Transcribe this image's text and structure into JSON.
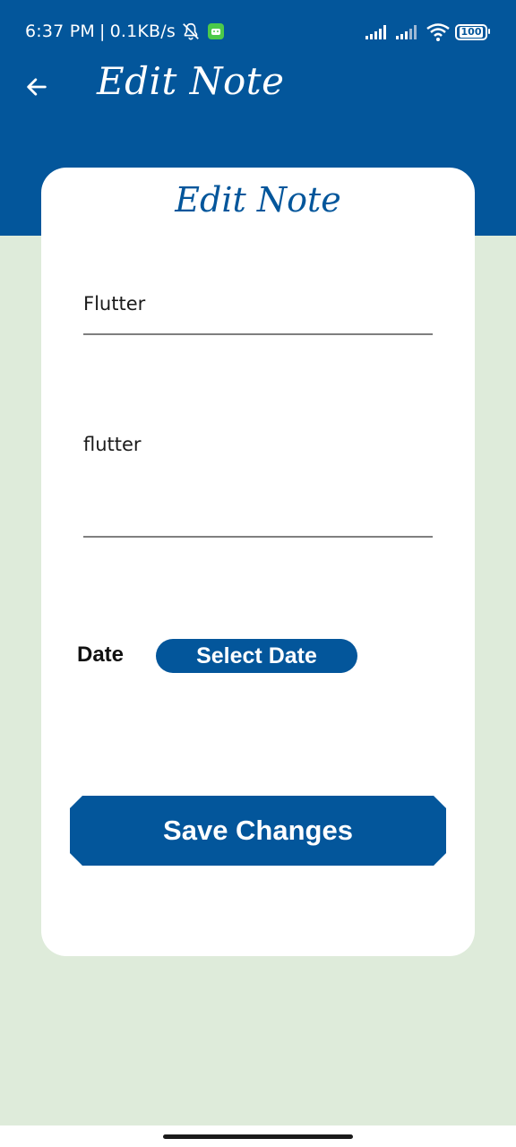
{
  "status_bar": {
    "time": "6:37 PM",
    "separator": "|",
    "net_speed": "0.1KB/s",
    "battery": "100",
    "icons": [
      "bell-off-icon",
      "android-icon",
      "signal-icon",
      "signal-icon",
      "wifi-icon",
      "battery-icon"
    ]
  },
  "app_bar": {
    "back_icon": "arrow-left-icon",
    "title": "Edit Note"
  },
  "card": {
    "title": "Edit Note",
    "note_title_value": "Flutter",
    "note_description_value": "flutter",
    "date_label": "Date",
    "select_date_label": "Select Date",
    "save_label": "Save Changes"
  },
  "colors": {
    "primary": "#03569b",
    "background": "#deebda",
    "card": "#ffffff"
  }
}
